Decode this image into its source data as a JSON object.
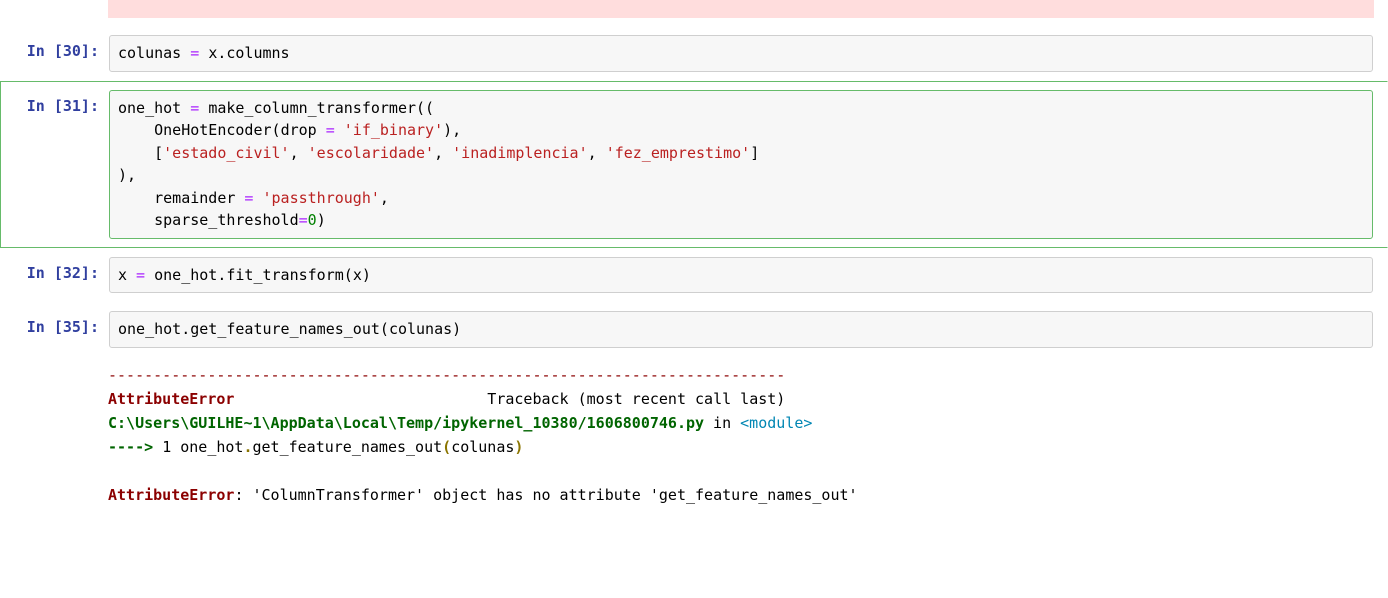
{
  "cells": [
    {
      "prompt": "In [30]:",
      "tokens": {
        "l1": {
          "v1": "colunas",
          "op1": " = ",
          "v2": "x",
          "dot": ".",
          "v3": "columns"
        }
      }
    },
    {
      "prompt": "In [31]:",
      "tokens": {
        "l1": {
          "v1": "one_hot",
          "op1": " = ",
          "v2": "make_column_transformer",
          "p1": "(("
        },
        "l2": {
          "pad": "    ",
          "v1": "OneHotEncoder",
          "p1": "(",
          "v2": "drop",
          "op1": " = ",
          "s1": "'if_binary'",
          "p2": "),"
        },
        "l3": {
          "pad": "    ",
          "p1": "[",
          "s1": "'estado_civil'",
          "c1": ", ",
          "s2": "'escolaridade'",
          "c2": ", ",
          "s3": "'inadimplencia'",
          "c3": ", ",
          "s4": "'fez_emprestimo'",
          "p2": "]"
        },
        "l4": {
          "v1": "),"
        },
        "l5": {
          "pad": "    ",
          "v1": "remainder",
          "op1": " = ",
          "s1": "'passthrough'",
          "c1": ","
        },
        "l6": {
          "pad": "    ",
          "v1": "sparse_threshold",
          "op1": "=",
          "n1": "0",
          "p1": ")"
        }
      }
    },
    {
      "prompt": "In [32]:",
      "tokens": {
        "l1": {
          "v1": "x",
          "op1": " = ",
          "v2": "one_hot",
          "dot": ".",
          "v3": "fit_transform",
          "p1": "(",
          "v4": "x",
          "p2": ")"
        }
      }
    },
    {
      "prompt": "In [35]:",
      "tokens": {
        "l1": {
          "v1": "one_hot",
          "dot": ".",
          "v2": "get_feature_names_out",
          "p1": "(",
          "v3": "colunas",
          "p2": ")"
        }
      }
    }
  ],
  "traceback": {
    "dashes": "---------------------------------------------------------------------------",
    "error_name": "AttributeError",
    "trace_label": "                            Traceback (most recent call last)",
    "path": "C:\\Users\\GUILHE~1\\AppData\\Local\\Temp/ipykernel_10380/1606800746.py",
    "in_word": " in ",
    "module": "<module>",
    "arrow": "----> ",
    "linenum": "1 ",
    "code_v1": "one_hot",
    "code_dot": ".",
    "code_v2": "get_feature_names_out",
    "code_p1": "(",
    "code_v3": "colunas",
    "code_p2": ")",
    "final_name": "AttributeError",
    "final_msg": ": 'ColumnTransformer' object has no attribute 'get_feature_names_out'"
  }
}
